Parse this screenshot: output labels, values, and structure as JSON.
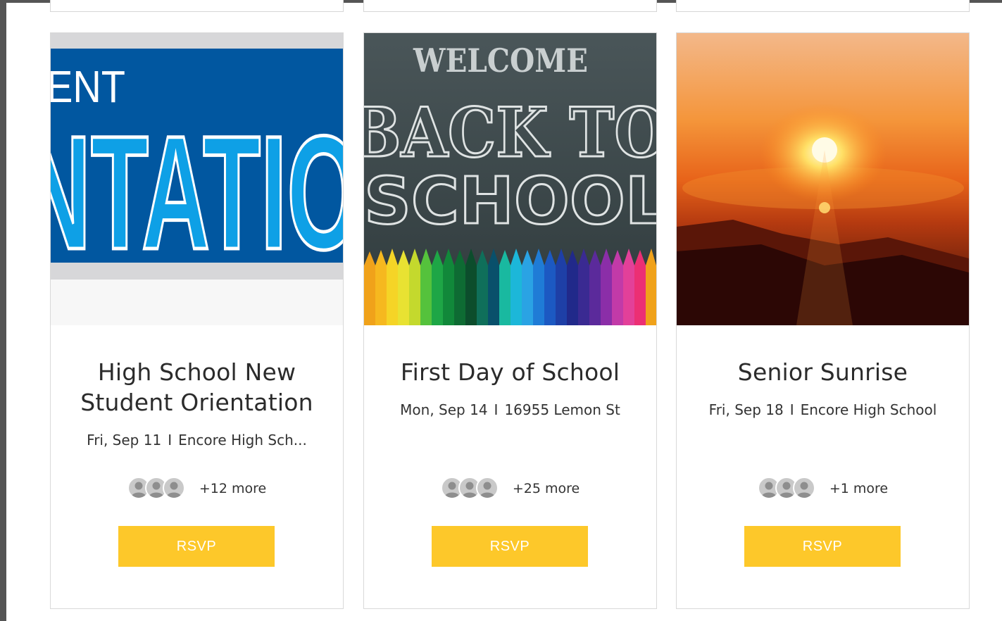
{
  "events": [
    {
      "title_lines": [
        "High School New",
        "Student Orientation"
      ],
      "image_text_1": "ENT",
      "image_text_2": "NTATIO",
      "date": "Fri, Sep 11",
      "location": "Encore High Sch...",
      "guests_more": "+12 more",
      "rsvp_label": "RSVP"
    },
    {
      "title_lines": [
        "First Day of School"
      ],
      "image_text_1": "WELCOME",
      "image_text_2": "BACK TO",
      "image_text_3": "SCHOOL",
      "date": "Mon, Sep 14",
      "location": "16955 Lemon St",
      "guests_more": "+25 more",
      "rsvp_label": "RSVP"
    },
    {
      "title_lines": [
        "Senior Sunrise"
      ],
      "date": "Fri, Sep 18",
      "location": "Encore High School",
      "guests_more": "+1 more",
      "rsvp_label": "RSVP"
    }
  ],
  "separator": "I",
  "colors": {
    "rsvp_button": "#fdc82a",
    "orientation_blue": "#0157a0",
    "chalkboard": "#3c4a4d"
  },
  "icons": {
    "avatar": "person-placeholder-icon"
  }
}
